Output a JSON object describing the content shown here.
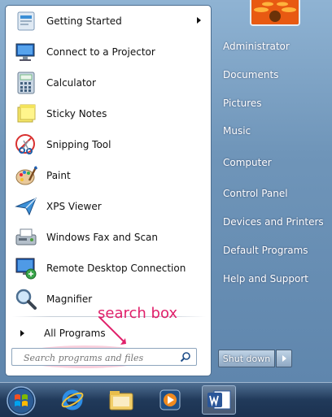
{
  "programs": [
    {
      "label": "Getting Started",
      "icon": "getting-started-icon",
      "has_submenu": true
    },
    {
      "label": "Connect to a Projector",
      "icon": "projector-icon",
      "has_submenu": false
    },
    {
      "label": "Calculator",
      "icon": "calculator-icon",
      "has_submenu": false
    },
    {
      "label": "Sticky Notes",
      "icon": "sticky-notes-icon",
      "has_submenu": false
    },
    {
      "label": "Snipping Tool",
      "icon": "scissors-icon",
      "has_submenu": false
    },
    {
      "label": "Paint",
      "icon": "paint-palette-icon",
      "has_submenu": false
    },
    {
      "label": "XPS Viewer",
      "icon": "xps-viewer-icon",
      "has_submenu": false
    },
    {
      "label": "Windows Fax and Scan",
      "icon": "fax-icon",
      "has_submenu": false
    },
    {
      "label": "Remote Desktop Connection",
      "icon": "remote-desktop-icon",
      "has_submenu": false
    },
    {
      "label": "Magnifier",
      "icon": "magnifier-icon",
      "has_submenu": false
    }
  ],
  "all_programs": {
    "label": "All Programs"
  },
  "search": {
    "placeholder": "Search programs and files"
  },
  "annotation": {
    "label": "search box",
    "color": "#e0206a"
  },
  "right_links": [
    {
      "label": "Administrator"
    },
    {
      "label": "Documents"
    },
    {
      "label": "Pictures"
    },
    {
      "label": "Music"
    },
    {
      "label": "Computer"
    },
    {
      "label": "Control Panel"
    },
    {
      "label": "Devices and Printers"
    },
    {
      "label": "Default Programs"
    },
    {
      "label": "Help and Support"
    }
  ],
  "shutdown": {
    "label": "Shut down"
  },
  "taskbar": {
    "items": [
      "start-orb-icon",
      "internet-explorer-icon",
      "file-explorer-icon",
      "media-player-icon",
      "word-icon"
    ]
  }
}
